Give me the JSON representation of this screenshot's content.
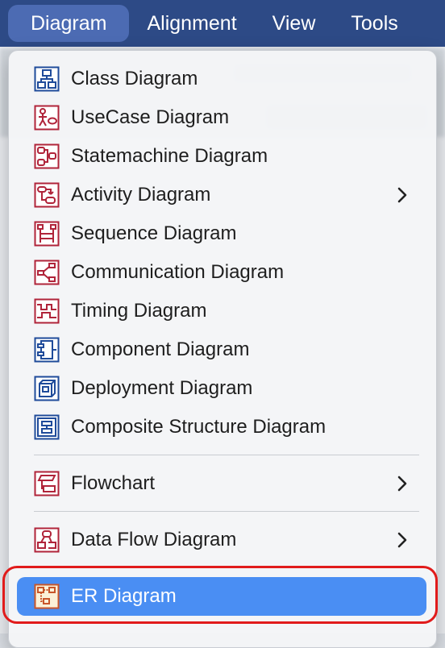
{
  "menubar": {
    "items": [
      {
        "label": "Diagram",
        "active": true
      },
      {
        "label": "Alignment"
      },
      {
        "label": "View"
      },
      {
        "label": "Tools"
      }
    ]
  },
  "menu": {
    "items": [
      {
        "label": "Class Diagram",
        "icon": "class-diagram-icon",
        "color": "#1f4b9a"
      },
      {
        "label": "UseCase Diagram",
        "icon": "usecase-diagram-icon",
        "color": "#b0243a"
      },
      {
        "label": "Statemachine Diagram",
        "icon": "statemachine-diagram-icon",
        "color": "#b0243a"
      },
      {
        "label": "Activity Diagram",
        "icon": "activity-diagram-icon",
        "color": "#b0243a",
        "submenu": true
      },
      {
        "label": "Sequence Diagram",
        "icon": "sequence-diagram-icon",
        "color": "#b0243a"
      },
      {
        "label": "Communication Diagram",
        "icon": "communication-diagram-icon",
        "color": "#b0243a"
      },
      {
        "label": "Timing Diagram",
        "icon": "timing-diagram-icon",
        "color": "#b0243a"
      },
      {
        "label": "Component Diagram",
        "icon": "component-diagram-icon",
        "color": "#1f4b9a"
      },
      {
        "label": "Deployment Diagram",
        "icon": "deployment-diagram-icon",
        "color": "#1f4b9a"
      },
      {
        "label": "Composite Structure Diagram",
        "icon": "composite-structure-diagram-icon",
        "color": "#1f4b9a"
      },
      {
        "label": "Flowchart",
        "icon": "flowchart-icon",
        "color": "#b0243a",
        "submenu": true
      },
      {
        "label": "Data Flow Diagram",
        "icon": "data-flow-diagram-icon",
        "color": "#b0243a",
        "submenu": true
      },
      {
        "label": "ER Diagram",
        "icon": "er-diagram-icon",
        "color": "#c8562a",
        "highlighted": true
      }
    ]
  },
  "colors": {
    "menubar": "#2d4a86",
    "highlight": "#4a8ef3",
    "focus_ring": "#e11b1b"
  }
}
